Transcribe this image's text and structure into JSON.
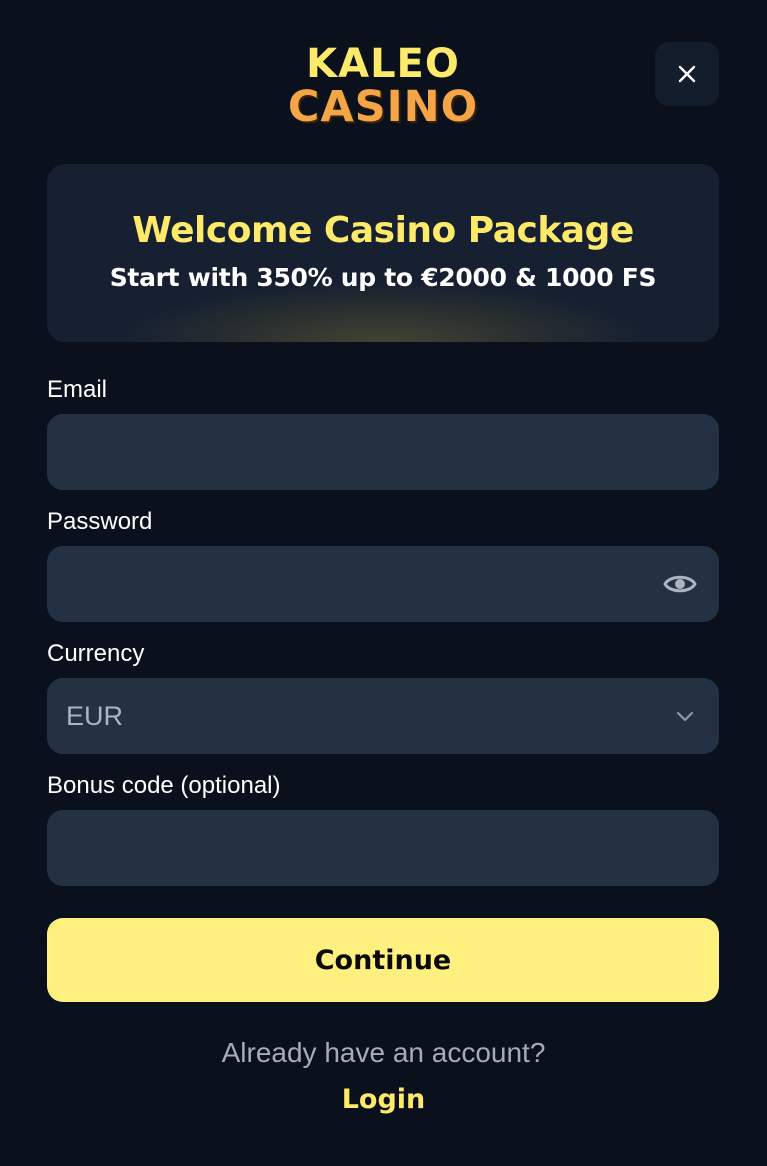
{
  "brand": {
    "logo_line1": "KALEO",
    "logo_line2": "CASINO"
  },
  "icons": {
    "close": "close-icon",
    "eye": "eye-icon",
    "chevron": "chevron-down-icon"
  },
  "promo": {
    "title": "Welcome Casino Package",
    "subtitle": "Start with 350% up to €2000 & 1000 FS"
  },
  "form": {
    "email": {
      "label": "Email",
      "value": "",
      "placeholder": ""
    },
    "password": {
      "label": "Password",
      "value": "",
      "placeholder": ""
    },
    "currency": {
      "label": "Currency",
      "selected": "EUR"
    },
    "bonus": {
      "label": "Bonus code (optional)",
      "value": "",
      "placeholder": ""
    },
    "submit_label": "Continue"
  },
  "footer": {
    "prompt": "Already have an account?",
    "login_label": "Login"
  },
  "colors": {
    "background": "#0a111d",
    "field_bg": "#243143",
    "accent_yellow": "#fdea6b",
    "button_yellow": "#fdf07f",
    "logo_orange": "#f3a548"
  }
}
